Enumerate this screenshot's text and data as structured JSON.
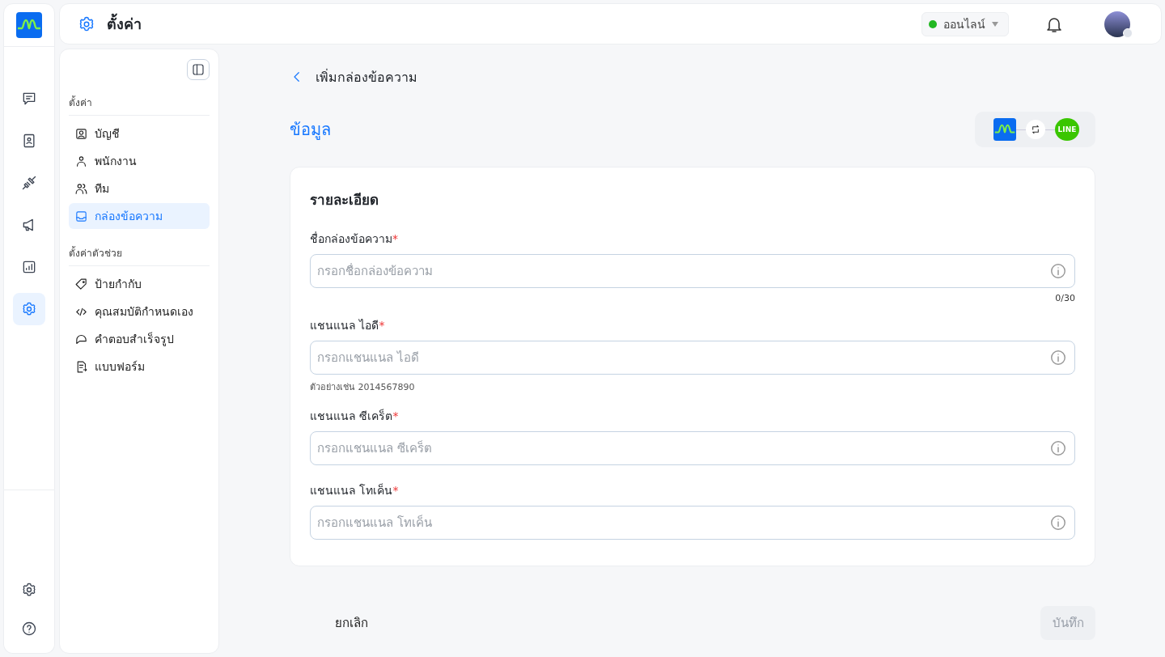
{
  "rail": {
    "nav": [
      {
        "selected": false
      },
      {
        "selected": false
      },
      {
        "selected": false
      },
      {
        "selected": false
      },
      {
        "selected": false
      },
      {
        "selected": true
      }
    ]
  },
  "header": {
    "title": "ตั้งค่า",
    "status": {
      "label": "ออนไลน์",
      "color": "#22b822"
    }
  },
  "settings_sidebar": {
    "sections": [
      {
        "title": "ตั้งค่า",
        "items": [
          {
            "label": "บัญชี",
            "selected": false
          },
          {
            "label": "พนักงาน",
            "selected": false
          },
          {
            "label": "ทีม",
            "selected": false
          },
          {
            "label": "กล่องข้อความ",
            "selected": true
          }
        ]
      },
      {
        "title": "ตั้งค่าตัวช่วย",
        "items": [
          {
            "label": "ป้ายกำกับ",
            "selected": false
          },
          {
            "label": "คุณสมบัติกำหนดเอง",
            "selected": false
          },
          {
            "label": "คำตอบสำเร็จรูป",
            "selected": false
          },
          {
            "label": "แบบฟอร์ม",
            "selected": false
          }
        ]
      }
    ]
  },
  "page": {
    "back_title": "เพิ่มกล่องข้อความ",
    "section_title": "ข้อมูล",
    "line_logo_text": "LINE",
    "card": {
      "title": "รายละเอียด",
      "fields": [
        {
          "label": "ชื่อกล่องข้อความ",
          "required_mark": "*",
          "placeholder": "กรอกชื่อกล่องข้อความ",
          "counter": "0/30"
        },
        {
          "label": "แชนแนล ไอดี",
          "required_mark": "*",
          "placeholder": "กรอกแชนแนล ไอดี",
          "hint": "ตัวอย่างเช่น 2014567890"
        },
        {
          "label": "แชนแนล ซีเคร็ต",
          "required_mark": "*",
          "placeholder": "กรอกแชนแนล ซีเคร็ต"
        },
        {
          "label": "แชนแนล โทเค็น",
          "required_mark": "*",
          "placeholder": "กรอกแชนแนล โทเค็น"
        }
      ]
    },
    "cancel_button": "ยกเลิก",
    "save_button": {
      "label": "บันทึก",
      "disabled": true
    }
  }
}
